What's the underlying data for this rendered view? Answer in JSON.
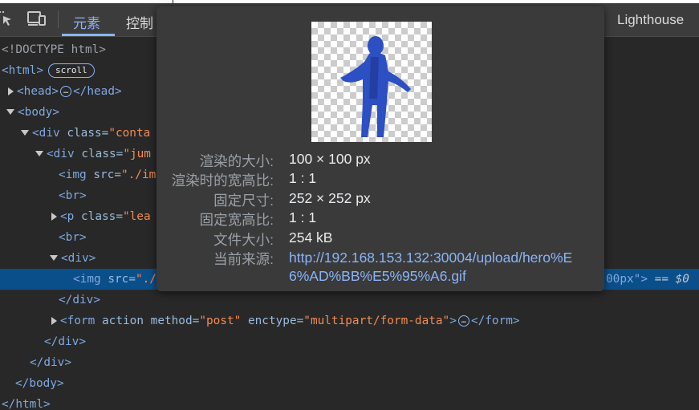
{
  "tabs": [
    "元素",
    "控制",
    "Lighthouse"
  ],
  "icons": [
    "inspect-element-icon",
    "device-toolbar-icon"
  ],
  "tree": {
    "doctype": "<!DOCTYPE html>",
    "html_open": "<html>",
    "scroll_badge": "scroll",
    "head_open": "<head>",
    "ellipsis": "…",
    "head_close": "</head>",
    "body_open": "<body>",
    "div1_tag": "<div",
    "div1_attr": "class=",
    "div1_val": "\"conta",
    "div2_tag": "<div",
    "div2_attr": "class=",
    "div2_val": "\"jum",
    "img1_tag": "<img",
    "img1_attr": "src=",
    "img1_val": "\"./im",
    "br1": "<br>",
    "p_tag": "<p",
    "p_attr": "class=",
    "p_val": "\"lea",
    "br2": "<br>",
    "div3_open": "<div>",
    "img2_tag": "<img",
    "img2_attr": "src=",
    "img2_val": "\"./",
    "img2_tail": "00px\">",
    "img2_dollar": "== $0",
    "div3_close": "</div>",
    "form_tag": "<form",
    "form_attr1": "action",
    "form_attr2": "method=",
    "form_val2": "\"post\"",
    "form_attr3": "enctype=",
    "form_val3": "\"multipart/form-data\"",
    "form_gt": ">",
    "form_close": "</form>",
    "div_close1": "</div>",
    "div_close2": "</div>",
    "body_close": "</body>",
    "html_close": "</html>"
  },
  "tooltip": {
    "rows": [
      {
        "label": "渲染的大小:",
        "value": "100 × 100 px"
      },
      {
        "label": "渲染时的宽高比:",
        "value": "1 : 1"
      },
      {
        "label": "固定尺寸:",
        "value": "252 × 252 px"
      },
      {
        "label": "固定宽高比:",
        "value": "1 : 1"
      },
      {
        "label": "文件大小:",
        "value": "254 kB"
      }
    ],
    "source_label": "当前来源:",
    "source_url": "http://192.168.153.132:30004/upload/hero%E6%AD%BB%E5%95%A6.gif"
  },
  "colors": {
    "accent": "#8ab4f8",
    "tag": "#7fa8e0",
    "string": "#f28b54",
    "selected_row": "#0b4f8a",
    "figure": "#2d4fc4"
  }
}
